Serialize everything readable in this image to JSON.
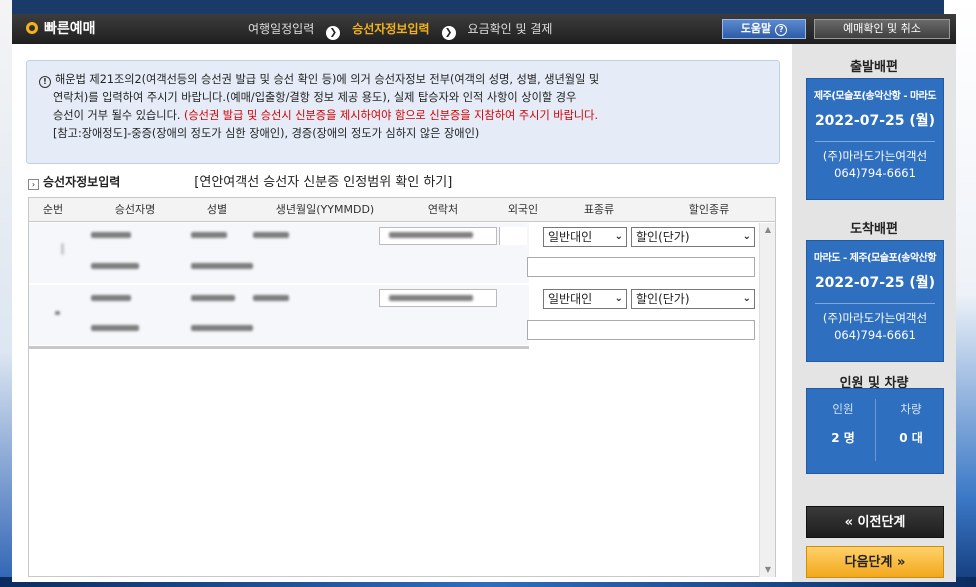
{
  "header": {
    "brand": "빠른예매",
    "steps": [
      {
        "label": "여행일정입력",
        "active": false
      },
      {
        "label": "승선자정보입력",
        "active": true
      },
      {
        "label": "요금확인 및 결제",
        "active": false
      }
    ],
    "help_label": "도움말",
    "cancel_label": "예매확인 및 취소"
  },
  "notice": {
    "line1": "해운법 제21조의2(여객선등의 승선권 발급 및 승선 확인 등)에 의거 승선자정보 전부(여객의 성명, 성별, 생년월일 및",
    "line2": "연락처)를 입력하여 주시기 바랍니다.(예매/입출항/결항 정보 제공 용도), 실제 탑승자와 인적 사항이 상이할 경우",
    "line3_plain": "승선이 거부 될수 있습니다. ",
    "line3_red": "(승선권 발급 및 승선시 신분증을 제시하여야 함으로 신분증을 지참하여 주시기 바랍니다.",
    "line4": "[참고:장애정도]-중증(장애의 정도가 심한 장애인), 경증(장애의 정도가 심하지 않은 장애인)"
  },
  "section": {
    "title": "승선자정보입력",
    "id_link": "[연안여객선 승선자 신분증 인정범위 확인 하기]"
  },
  "table": {
    "headers": [
      "순번",
      "승선자명",
      "성별",
      "생년월일(YYMMDD)",
      "연락처",
      "외국인",
      "표종류",
      "할인종류"
    ],
    "rows": [
      {
        "ticket_type": "일반대인",
        "discount": "할인(단가)"
      },
      {
        "ticket_type": "일반대인",
        "discount": "할인(단가)"
      }
    ]
  },
  "side": {
    "departure_label": "출발배편",
    "departure": {
      "route": "제주(모슬포(송악산항 - 마라도",
      "date": "2022-07-25 (월)",
      "company": "(주)마라도가는여객선",
      "phone": "064)794-6661"
    },
    "arrival_label": "도착배편",
    "arrival": {
      "route": "마라도 - 제주(모슬포(송악산항",
      "date": "2022-07-25 (월)",
      "company": "(주)마라도가는여객선",
      "phone": "064)794-6661"
    },
    "pax_label": "인원 및 차량",
    "pax": {
      "people_label": "인원",
      "people_value": "2 명",
      "vehicle_label": "차량",
      "vehicle_value": "0 대"
    },
    "prev_label": "« 이전단계",
    "next_label": "다음단계 »"
  },
  "colors": {
    "accent": "#f2b21c",
    "card_blue": "#2f6fc0",
    "notice_red": "#d40000"
  }
}
